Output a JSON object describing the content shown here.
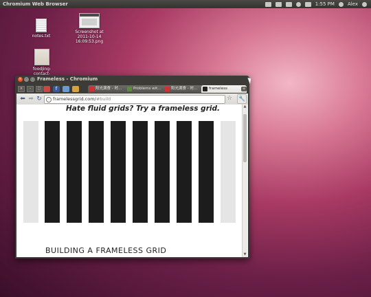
{
  "panel": {
    "app_title": "Chromium Web Browser",
    "clock": "1:55 PM",
    "user": "Alex"
  },
  "desktop": {
    "icons": [
      {
        "label": "notes.txt"
      },
      {
        "label": "Screenshot at 2011-10-14 16:09:53.png"
      },
      {
        "label": "foodjing-contact-form.png"
      }
    ]
  },
  "window": {
    "title": "Frameless - Chromium",
    "tabs": [
      {
        "label": "阳光满食 - 时…",
        "favicon_color": "#cc3333"
      },
      {
        "label": "Problems wit…",
        "favicon_color": "#5a8f3a"
      },
      {
        "label": "阳光满食 - 时…",
        "favicon_color": "#cc3333"
      },
      {
        "label": "frameless",
        "favicon_color": "#222222"
      }
    ],
    "url_host": "framelessgrid.com/",
    "url_path": "#build"
  },
  "page": {
    "headline": "Hate fluid grids? Try a frameless grid.",
    "section_heading": "BUILDING A FRAMELESS GRID",
    "column_color": "#1c1c1c",
    "ghost_column_color": "#e5e5e5"
  }
}
